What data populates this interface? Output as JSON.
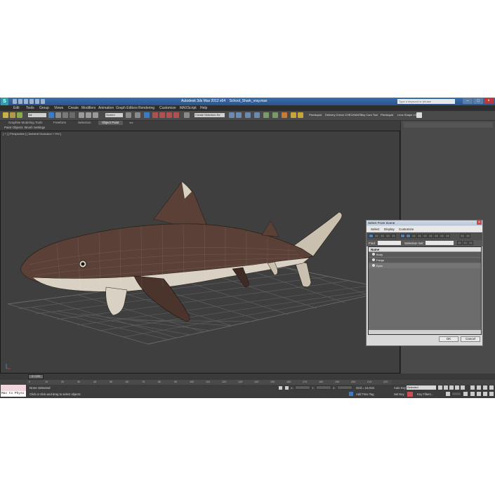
{
  "titlebar": {
    "app_title": "Autodesk 3ds Max 2012 x64",
    "file_name": "School_Shark_vray.max",
    "search_placeholder": "Type a keyword or phrase"
  },
  "menu": [
    "Edit",
    "Tools",
    "Group",
    "Views",
    "Create",
    "Modifiers",
    "Animation",
    "Graph Editors",
    "Rendering",
    "Customize",
    "MAXScript",
    "Help"
  ],
  "toolbar": {
    "filter_value": "All",
    "coord_value": "Screen",
    "selection_set_value": "Create Selection Se",
    "text_items": [
      "Pixelsquid",
      "Delivery Check",
      "CHECKMATE",
      "Joy Cam Tool",
      "Pixelsquid",
      "Lens Shape v3"
    ]
  },
  "ribbon": {
    "tabs": [
      "Graphite Modeling Tools",
      "Freeform",
      "Selection",
      "Object Paint"
    ],
    "active_tab": "Object Paint",
    "subtabs": [
      "Paint Objects",
      "Brush Settings"
    ]
  },
  "viewport": {
    "label": "[ + ] [ Perspective ] [ Ambient Occlusion + HVr ]"
  },
  "dialog": {
    "title": "Select From Scene",
    "menu": [
      "Select",
      "Display",
      "Customize"
    ],
    "find_label": "Find:",
    "selection_set_label": "Selection Set:",
    "column_header": "Name",
    "items": [
      "Body",
      "Fangs",
      "Eyes"
    ],
    "ok_label": "OK",
    "cancel_label": "Cancel"
  },
  "timeline": {
    "frame_label": "0 / 225",
    "ticks": [
      "0",
      "10",
      "20",
      "30",
      "40",
      "50",
      "60",
      "70",
      "80",
      "90",
      "100",
      "110",
      "120",
      "130",
      "140",
      "150",
      "160",
      "170",
      "180",
      "190",
      "200",
      "210",
      "220"
    ]
  },
  "status": {
    "maxscript_label": "Max to Physx",
    "selection_status": "None Selected",
    "prompt": "Click or click-and-drag to select objects",
    "grid_label": "Grid = 10,0cm",
    "add_time_tag": "Add Time Tag",
    "auto_key": "Auto Key",
    "auto_key_value": "Selected",
    "set_key": "Set Key",
    "key_filters": "Key Filters..."
  },
  "colors": {
    "title_blue": "#2a548a",
    "viewport_bg": "#3f3f3f",
    "highlight": "#2f6fbf",
    "shark_dark": "#5a4036",
    "shark_light": "#d9d2c4"
  }
}
